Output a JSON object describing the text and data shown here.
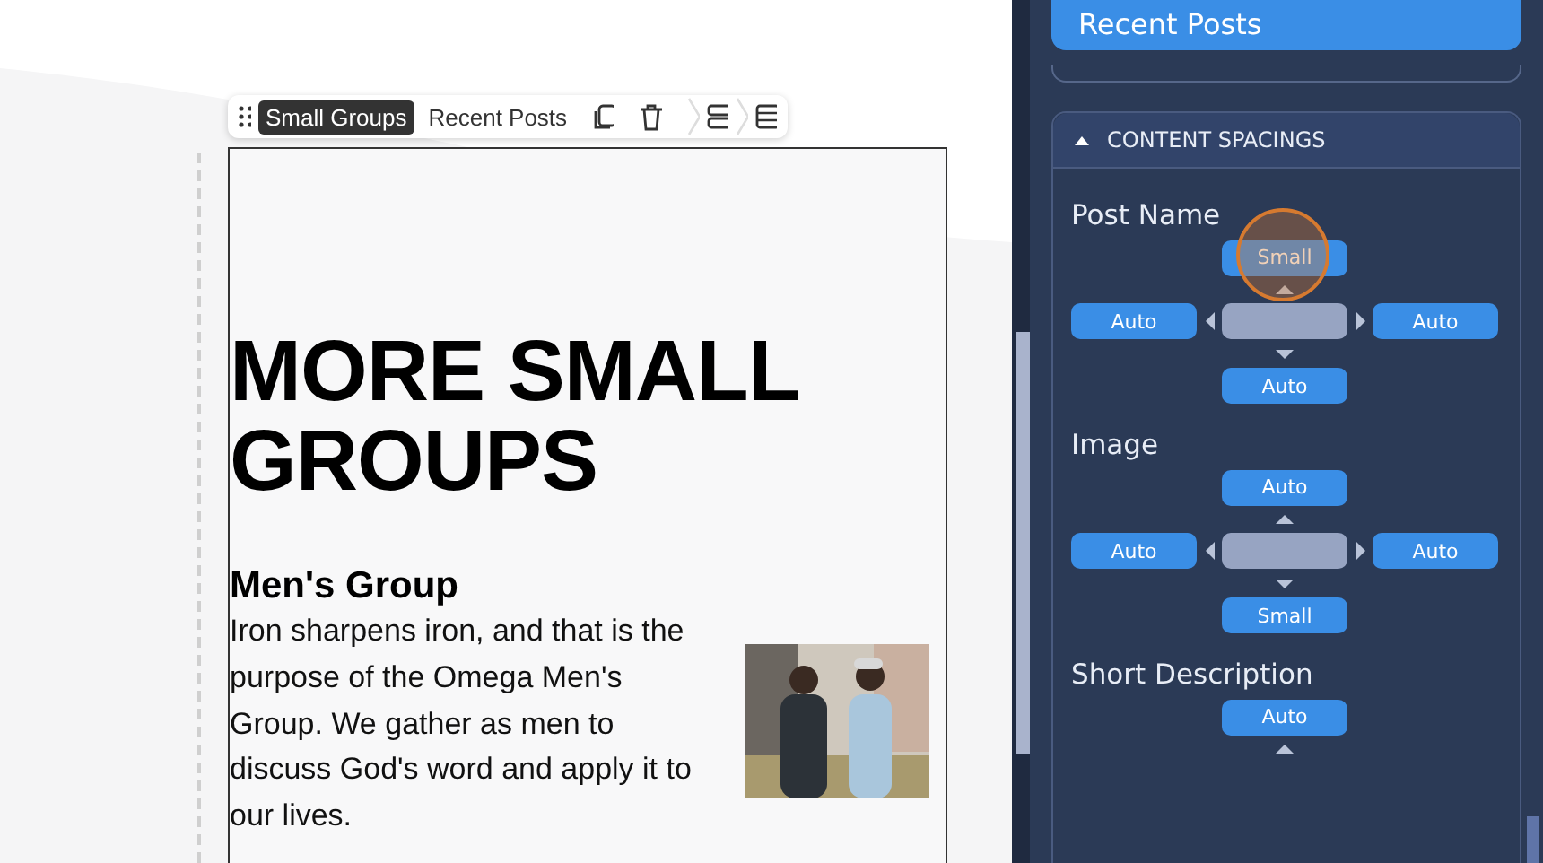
{
  "toolbar": {
    "items": [
      {
        "label": "Small Groups",
        "selected": true
      },
      {
        "label": "Recent Posts",
        "selected": false
      }
    ]
  },
  "content": {
    "heading": "MORE SMALL GROUPS",
    "post": {
      "title": "Men's Group",
      "text": "Iron sharpens iron, and that is the purpose of the Omega Men's Group. We gather as men to discuss God's word and apply it to our lives."
    }
  },
  "sidebar": {
    "top_button": "Recent Posts",
    "section": {
      "title": "CONTENT SPACINGS",
      "expanded": true,
      "groups": [
        {
          "name": "Post Name",
          "top": "Small",
          "left": "Auto",
          "right": "Auto",
          "bottom": "Auto",
          "highlighted": true
        },
        {
          "name": "Image",
          "top": "Auto",
          "left": "Auto",
          "right": "Auto",
          "bottom": "Small",
          "highlighted": false
        },
        {
          "name": "Short Description",
          "top": "Auto",
          "highlighted": false
        }
      ]
    }
  }
}
